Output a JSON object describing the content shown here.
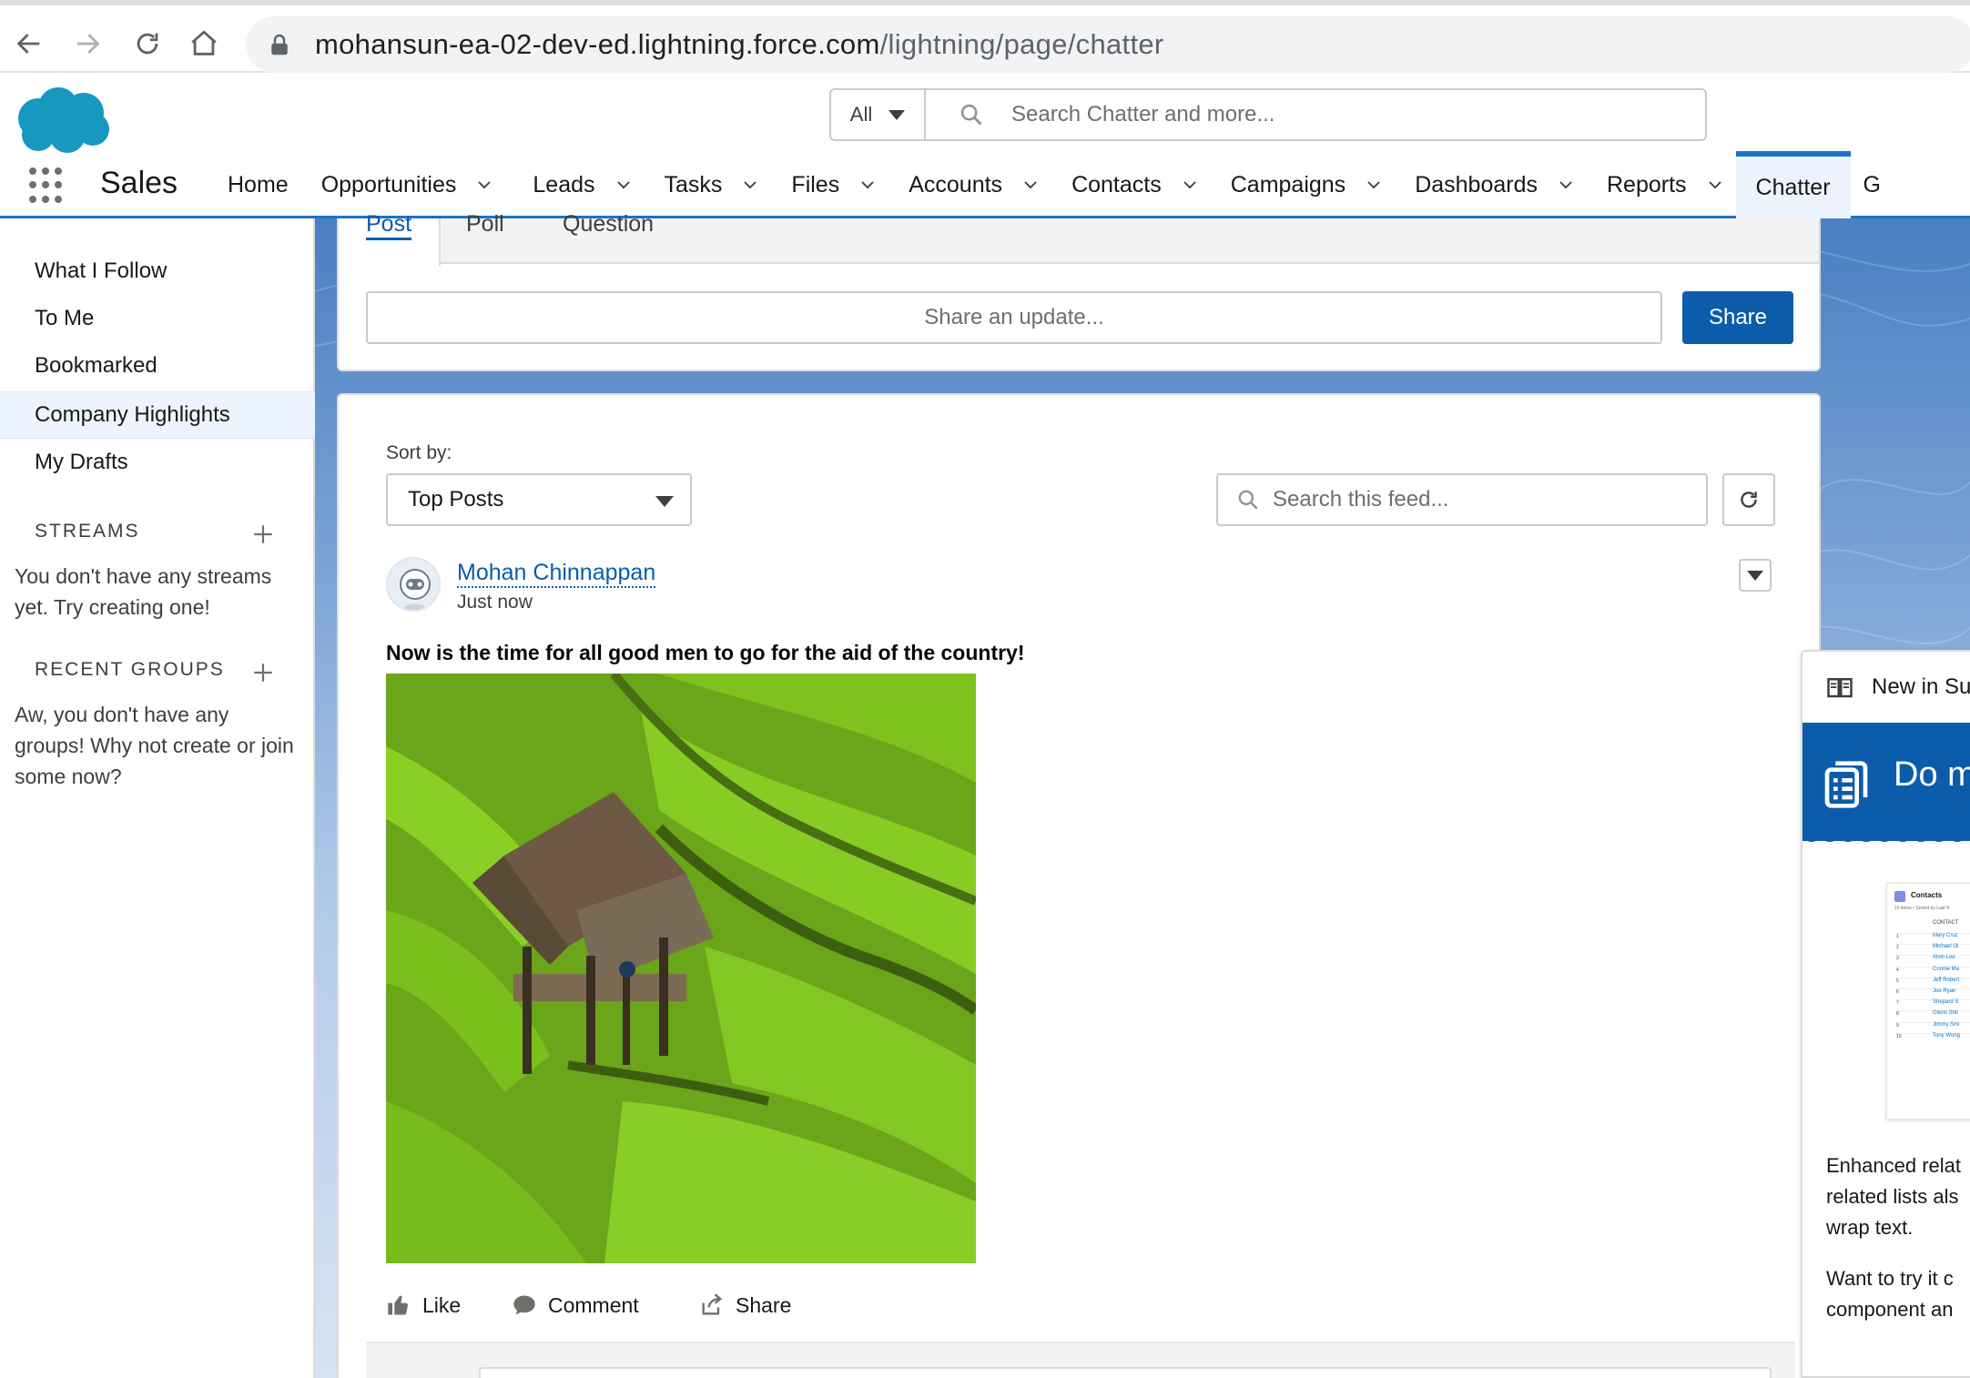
{
  "browser": {
    "url_host": "mohansun-ea-02-dev-ed.lightning.force.com",
    "url_path": "/lightning/page/chatter"
  },
  "header": {
    "search_scope": "All",
    "search_placeholder": "Search Chatter and more...",
    "app_name": "Sales",
    "nav_tabs": [
      {
        "label": "Home",
        "has_menu": false
      },
      {
        "label": "Opportunities",
        "has_menu": true
      },
      {
        "label": "Leads",
        "has_menu": true
      },
      {
        "label": "Tasks",
        "has_menu": true
      },
      {
        "label": "Files",
        "has_menu": true
      },
      {
        "label": "Accounts",
        "has_menu": true
      },
      {
        "label": "Contacts",
        "has_menu": true
      },
      {
        "label": "Campaigns",
        "has_menu": true
      },
      {
        "label": "Dashboards",
        "has_menu": true
      },
      {
        "label": "Reports",
        "has_menu": true
      },
      {
        "label": "Chatter",
        "has_menu": false,
        "active": true
      },
      {
        "label": "G",
        "has_menu": false
      }
    ]
  },
  "sidebar": {
    "items": [
      "What I Follow",
      "To Me",
      "Bookmarked",
      "Company Highlights",
      "My Drafts"
    ],
    "selected": "Company Highlights",
    "streams_title": "STREAMS",
    "streams_note": "You don't have any streams yet. Try creating one!",
    "groups_title": "RECENT GROUPS",
    "groups_note": "Aw, you don't have any groups! Why not create or join some now?"
  },
  "publisher": {
    "tabs": [
      "Post",
      "Poll",
      "Question"
    ],
    "placeholder": "Share an update...",
    "share_label": "Share"
  },
  "feed": {
    "sort_label": "Sort by:",
    "sort_value": "Top Posts",
    "search_placeholder": "Search this feed...",
    "post": {
      "author": "Mohan Chinnappan",
      "time": "Just now",
      "body": "Now is the time for all good men to go for the aid of the country!",
      "actions": {
        "like": "Like",
        "comment": "Comment",
        "share": "Share"
      }
    }
  },
  "right_panel": {
    "header": "New in Su",
    "banner_title": "Do m",
    "mini_title": "Contacts",
    "mini_subtitle": "10 items • Sorted by Last N",
    "mini_column": "CONTACT",
    "mini_rows": [
      "Mary Cruz",
      "Michael Ol",
      "Alvin Lee",
      "Connie Ma",
      "Jeff Robert",
      "Joe Ryan",
      "Shepard S",
      "Glenn Shil",
      "Jimmy Smi",
      "Tony Wong"
    ],
    "text_lines_1": [
      "Enhanced relat",
      "related lists als",
      "wrap text."
    ],
    "text_lines_2": [
      "Want to try it c",
      "component an"
    ]
  },
  "colors": {
    "brand_blue": "#0b5cab",
    "nav_active_bar": "#1b74c8",
    "salesforce_cloud": "#1798c1"
  }
}
